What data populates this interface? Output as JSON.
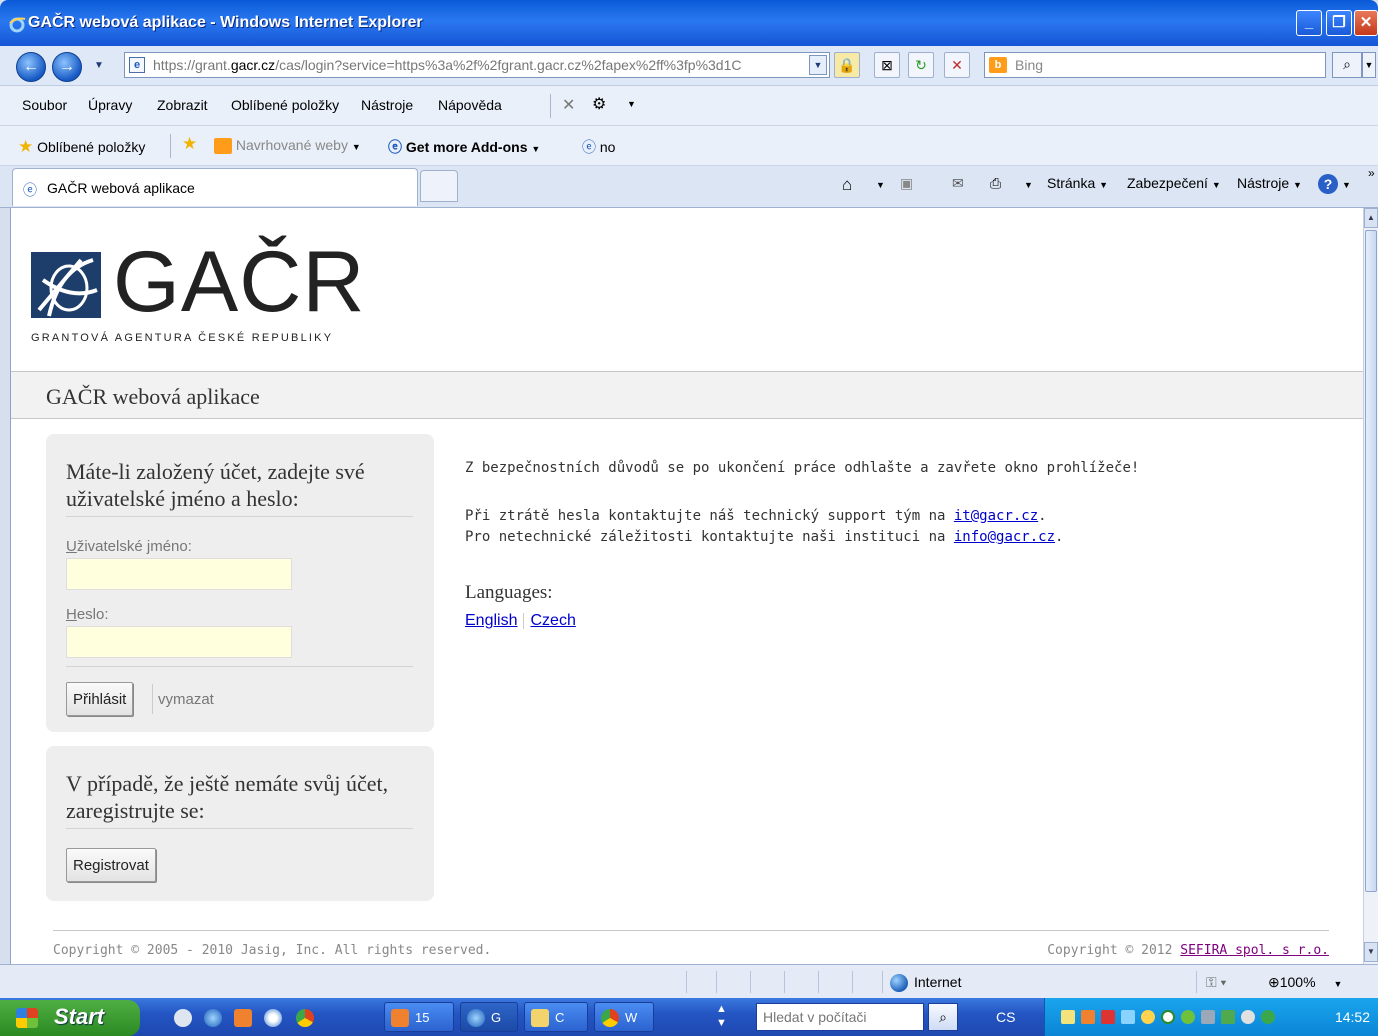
{
  "window": {
    "title": "GAČR webová aplikace - Windows Internet Explorer"
  },
  "address_bar": {
    "url_prefix": "https://grant.",
    "url_domain": "gacr.cz",
    "url_rest": "/cas/login?service=https%3a%2f%2fgrant.gacr.cz%2fapex%2ff%3fp%3d1C",
    "search_placeholder": "Bing"
  },
  "menu": {
    "items": [
      "Soubor",
      "Úpravy",
      "Zobrazit",
      "Oblíbené položky",
      "Nástroje",
      "Nápověda"
    ]
  },
  "favorites_bar": {
    "favorites_label": "Oblíbené položky",
    "suggested_sites": "Navrhované weby",
    "get_addons": "Get more Add-ons",
    "link_no": "no"
  },
  "tabs": {
    "active_tab": "GAČR webová aplikace"
  },
  "command_bar": {
    "page": "Stránka",
    "safety": "Zabezpečení",
    "tools": "Nástroje"
  },
  "page": {
    "logo_text": "GAČR",
    "logo_subtitle": "GRANTOVÁ AGENTURA ČESKÉ REPUBLIKY",
    "app_title": "GAČR webová aplikace",
    "login": {
      "heading": "Máte-li založený účet, zadejte své uživatelské jméno a heslo:",
      "username_label_accesskey": "U",
      "username_label_rest": "živatelské jméno:",
      "username_value": "",
      "password_label_accesskey": "H",
      "password_label_rest": "eslo:",
      "password_value": "",
      "submit": "Přihlásit",
      "clear": "vymazat"
    },
    "register": {
      "heading": "V případě, že ještě nemáte svůj účet, zaregistrujte se:",
      "button": "Registrovat"
    },
    "info": {
      "security_note": "Z bezpečnostních důvodů se po ukončení práce odhlašte a zavřete okno prohlížeče!",
      "lost_password_text": "Při ztrátě hesla kontaktujte náš technický support tým na ",
      "lost_password_email": "it@gacr.cz",
      "nontech_text": "Pro netechnické záležitosti kontaktujte naši instituci na ",
      "nontech_email": "info@gacr.cz",
      "period": "."
    },
    "languages": {
      "title": "Languages:",
      "english": "English",
      "czech": "Czech"
    },
    "footer": {
      "left": "Copyright © 2005 - 2010 Jasig, Inc. All rights reserved.",
      "right_prefix": "Copyright © 2012 ",
      "right_link": "SEFIRA spol. s r.o."
    }
  },
  "status_bar": {
    "zone": "Internet",
    "zoom": "100%"
  },
  "taskbar": {
    "start": "Start",
    "tasks": [
      "15",
      "G",
      "C",
      "W"
    ],
    "search_placeholder": "Hledat v počítači",
    "language": "CS",
    "clock": "14:52"
  },
  "colors": {
    "title_bar": "#1f66e0",
    "link": "#0000cc",
    "visited_link": "#800080",
    "input_bg": "#ffffdd",
    "panel_bg": "#eeeeee",
    "start_green": "#3a9c2f"
  }
}
